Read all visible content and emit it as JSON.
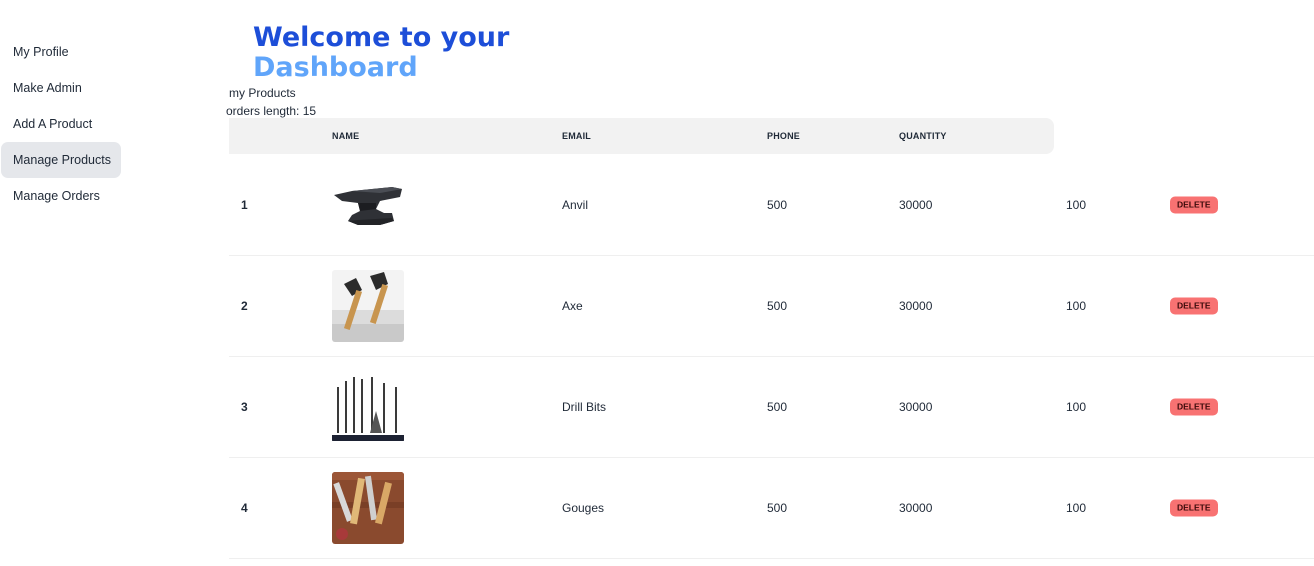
{
  "sidebar": {
    "items": [
      {
        "label": "My Profile",
        "active": false
      },
      {
        "label": "Make Admin",
        "active": false
      },
      {
        "label": "Add A Product",
        "active": false
      },
      {
        "label": "Manage Products",
        "active": true
      },
      {
        "label": "Manage Orders",
        "active": false
      }
    ]
  },
  "header": {
    "welcome_line1": "Welcome to your",
    "welcome_line2": "Dashboard"
  },
  "info": {
    "title": "my Products",
    "orders_length": "orders length: 15"
  },
  "table": {
    "columns": [
      "",
      "NAME",
      "EMAIL",
      "PHONE",
      "QUANTITY"
    ],
    "delete_label": "DELETE",
    "rows": [
      {
        "index": "1",
        "image": "anvil-image",
        "name": "Anvil",
        "email": "500",
        "phone": "30000",
        "quantity": "100"
      },
      {
        "index": "2",
        "image": "axe-image",
        "name": "Axe",
        "email": "500",
        "phone": "30000",
        "quantity": "100"
      },
      {
        "index": "3",
        "image": "drill-bits-image",
        "name": "Drill Bits",
        "email": "500",
        "phone": "30000",
        "quantity": "100"
      },
      {
        "index": "4",
        "image": "gouges-image",
        "name": "Gouges",
        "email": "500",
        "phone": "30000",
        "quantity": "100"
      }
    ]
  },
  "colors": {
    "welcome_primary": "#1d4ed8",
    "welcome_secondary": "#60a5fa",
    "delete_button": "#f87272",
    "active_sidebar": "#e5e7eb"
  }
}
